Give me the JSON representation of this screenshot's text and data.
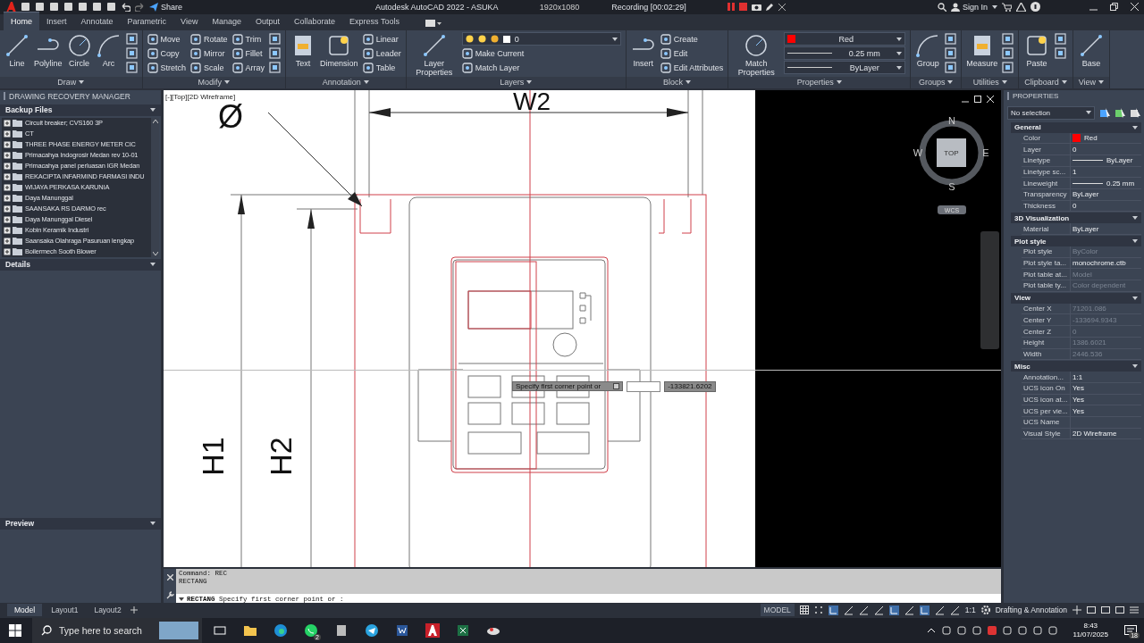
{
  "title_bar": {
    "share": "Share",
    "title": "Autodesk AutoCAD 2022 - ASUKA",
    "resolution": "1920x1080",
    "recording": "Recording [00:02:29]",
    "sign_in": "Sign In"
  },
  "ribbon_tabs": [
    {
      "label": "Home",
      "selected": true
    },
    {
      "label": "Insert",
      "selected": false
    },
    {
      "label": "Annotate",
      "selected": false
    },
    {
      "label": "Parametric",
      "selected": false
    },
    {
      "label": "View",
      "selected": false
    },
    {
      "label": "Manage",
      "selected": false
    },
    {
      "label": "Output",
      "selected": false
    },
    {
      "label": "Collaborate",
      "selected": false
    },
    {
      "label": "Express Tools",
      "selected": false
    }
  ],
  "ribbon_panels": [
    {
      "title": "Draw",
      "tools": [
        {
          "kind": "large",
          "label": "Line"
        },
        {
          "kind": "large",
          "label": "Polyline"
        },
        {
          "kind": "large",
          "label": "Circle"
        },
        {
          "kind": "large",
          "label": "Arc"
        },
        {
          "kind": "icon"
        },
        {
          "kind": "icon"
        },
        {
          "kind": "icon"
        }
      ]
    },
    {
      "title": "Modify",
      "tools": [
        {
          "kind": "small",
          "label": "Move"
        },
        {
          "kind": "small",
          "label": "Copy"
        },
        {
          "kind": "small",
          "label": "Stretch"
        },
        {
          "kind": "small",
          "label": "Rotate"
        },
        {
          "kind": "small",
          "label": "Mirror"
        },
        {
          "kind": "small",
          "label": "Scale"
        },
        {
          "kind": "small",
          "label": "Trim"
        },
        {
          "kind": "small",
          "label": "Fillet"
        },
        {
          "kind": "small",
          "label": "Array"
        },
        {
          "kind": "icon"
        },
        {
          "kind": "icon"
        },
        {
          "kind": "icon"
        }
      ]
    },
    {
      "title": "Annotation",
      "tools": [
        {
          "kind": "large",
          "label": "Text"
        },
        {
          "kind": "large",
          "label": "Dimension"
        },
        {
          "kind": "small",
          "label": "Linear"
        },
        {
          "kind": "small",
          "label": "Leader"
        },
        {
          "kind": "small",
          "label": "Table"
        }
      ]
    },
    {
      "title": "Layers",
      "tools": [
        {
          "kind": "large",
          "label": "Layer Properties"
        },
        {
          "kind": "layer-dropdown",
          "label": "0"
        },
        {
          "kind": "small",
          "label": "Make Current"
        },
        {
          "kind": "small",
          "label": "Match Layer"
        }
      ]
    },
    {
      "title": "Block",
      "tools": [
        {
          "kind": "large",
          "label": "Insert"
        },
        {
          "kind": "small",
          "label": "Create"
        },
        {
          "kind": "small",
          "label": "Edit"
        },
        {
          "kind": "small",
          "label": "Edit Attributes"
        }
      ]
    },
    {
      "title": "Properties",
      "tools": [
        {
          "kind": "large",
          "label": "Match Properties"
        },
        {
          "kind": "color-dropdown",
          "label": "Red",
          "color": "#ff0000"
        },
        {
          "kind": "line-dropdown",
          "label": "0.25 mm"
        },
        {
          "kind": "line-dropdown",
          "label": "ByLayer"
        }
      ]
    },
    {
      "title": "Groups",
      "tools": [
        {
          "kind": "large",
          "label": "Group"
        },
        {
          "kind": "icon"
        },
        {
          "kind": "icon"
        },
        {
          "kind": "icon"
        }
      ]
    },
    {
      "title": "Utilities",
      "tools": [
        {
          "kind": "large",
          "label": "Measure"
        },
        {
          "kind": "icon"
        },
        {
          "kind": "icon"
        },
        {
          "kind": "icon"
        }
      ]
    },
    {
      "title": "Clipboard",
      "tools": [
        {
          "kind": "large",
          "label": "Paste"
        },
        {
          "kind": "icon"
        },
        {
          "kind": "icon"
        }
      ]
    },
    {
      "title": "View",
      "tools": [
        {
          "kind": "large",
          "label": "Base"
        }
      ]
    }
  ],
  "recovery_panel": {
    "title": "DRAWING RECOVERY MANAGER",
    "sections": [
      {
        "title": "Backup Files",
        "items": [
          {
            "label": "Circuit breaker; CVS160 3P",
            "expanded": false
          },
          {
            "label": "CT",
            "expanded": false
          },
          {
            "label": "THREE PHASE ENERGY METER CIC",
            "expanded": false
          },
          {
            "label": "Primacahya Indogrosir Medan rev 10-01",
            "expanded": false
          },
          {
            "label": "Primacahya panel perluasan IGR Medan",
            "expanded": false
          },
          {
            "label": "REKACIPTA INFARMIND FARMASI INDU",
            "expanded": false
          },
          {
            "label": "WIJAYA PERKASA KARUNIA",
            "expanded": false
          },
          {
            "label": "Daya Manunggal",
            "expanded": false
          },
          {
            "label": "SAANSAKA RS DARMO rec",
            "expanded": false
          },
          {
            "label": "Daya Manunggal Diesel",
            "expanded": false
          },
          {
            "label": "Kobin Keramik Industri",
            "expanded": false
          },
          {
            "label": "Saansaka Olahraga Pasuruan lengkap",
            "expanded": false
          },
          {
            "label": "Boilermech Sooth Blower",
            "expanded": false
          }
        ]
      },
      {
        "title": "Details"
      },
      {
        "title": "Preview"
      }
    ]
  },
  "viewport": {
    "label": "[-][Top][2D Wireframe]",
    "drawing_texts": {
      "width_dim": "W2",
      "diameter": "Ø",
      "height_1": "H1",
      "height_2": "H2"
    },
    "view_cube": {
      "top": "TOP",
      "north": "N",
      "south": "S",
      "east": "E",
      "west": "W",
      "ucs": "WCS"
    },
    "dynamic_input": {
      "prompt": "Specify first corner point or",
      "y_value": "-133821.6202"
    }
  },
  "command_line": {
    "history": [
      "Command: REC",
      "RECTANG"
    ],
    "input": "**RECTANG** Specify first corner point or :"
  },
  "properties": {
    "title": "PROPERTIES",
    "selection": "No selection",
    "sections": [
      {
        "title": "General",
        "rows": [
          {
            "label": "Color",
            "value": "Red",
            "kind": "swatch",
            "color": "#ff0000",
            "disabled": false
          },
          {
            "label": "Layer",
            "value": "0",
            "kind": "text",
            "disabled": false
          },
          {
            "label": "Linetype",
            "value": "ByLayer",
            "kind": "line",
            "disabled": false
          },
          {
            "label": "Linetype sc...",
            "value": "1",
            "kind": "text",
            "disabled": false
          },
          {
            "label": "Lineweight",
            "value": "0.25 mm",
            "kind": "line",
            "disabled": false
          },
          {
            "label": "Transparency",
            "value": "ByLayer",
            "kind": "text",
            "disabled": false
          },
          {
            "label": "Thickness",
            "value": "0",
            "kind": "text",
            "disabled": false
          }
        ]
      },
      {
        "title": "3D Visualization",
        "rows": [
          {
            "label": "Material",
            "value": "ByLayer",
            "kind": "text",
            "disabled": false
          }
        ]
      },
      {
        "title": "Plot style",
        "rows": [
          {
            "label": "Plot style",
            "value": "ByColor",
            "kind": "text",
            "disabled": true
          },
          {
            "label": "Plot style ta...",
            "value": "monochrome.ctb",
            "kind": "text",
            "disabled": false
          },
          {
            "label": "Plot table at...",
            "value": "Model",
            "kind": "text",
            "disabled": true
          },
          {
            "label": "Plot table ty...",
            "value": "Color dependent",
            "kind": "text",
            "disabled": true
          }
        ]
      },
      {
        "title": "View",
        "rows": [
          {
            "label": "Center X",
            "value": "71201.086",
            "kind": "text",
            "disabled": true
          },
          {
            "label": "Center Y",
            "value": "-133694.9343",
            "kind": "text",
            "disabled": true
          },
          {
            "label": "Center Z",
            "value": "0",
            "kind": "text",
            "disabled": true
          },
          {
            "label": "Height",
            "value": "1386.6021",
            "kind": "text",
            "disabled": true
          },
          {
            "label": "Width",
            "value": "2446.536",
            "kind": "text",
            "disabled": true
          }
        ]
      },
      {
        "title": "Misc",
        "rows": [
          {
            "label": "Annotation...",
            "value": "1:1",
            "kind": "text",
            "disabled": false
          },
          {
            "label": "UCS icon On",
            "value": "Yes",
            "kind": "text",
            "disabled": false
          },
          {
            "label": "UCS icon at...",
            "value": "Yes",
            "kind": "text",
            "disabled": false
          },
          {
            "label": "UCS per vie...",
            "value": "Yes",
            "kind": "text",
            "disabled": false
          },
          {
            "label": "UCS Name",
            "kind": "text",
            "disabled": false
          },
          {
            "label": "Visual Style",
            "value": "2D Wireframe",
            "kind": "text",
            "disabled": false
          }
        ]
      }
    ]
  },
  "layout_tabs": [
    {
      "label": "Model",
      "selected": true
    },
    {
      "label": "Layout1",
      "selected": false
    },
    {
      "label": "Layout2",
      "selected": false
    }
  ],
  "status_bar": {
    "space": "MODEL",
    "scale": "1:1",
    "workspace": "Drafting & Annotation"
  },
  "taskbar": {
    "search_placeholder": "Type here to search",
    "whatsapp_badge": "2",
    "time": "8:43",
    "date": "11/07/2025",
    "notifications": "18"
  }
}
